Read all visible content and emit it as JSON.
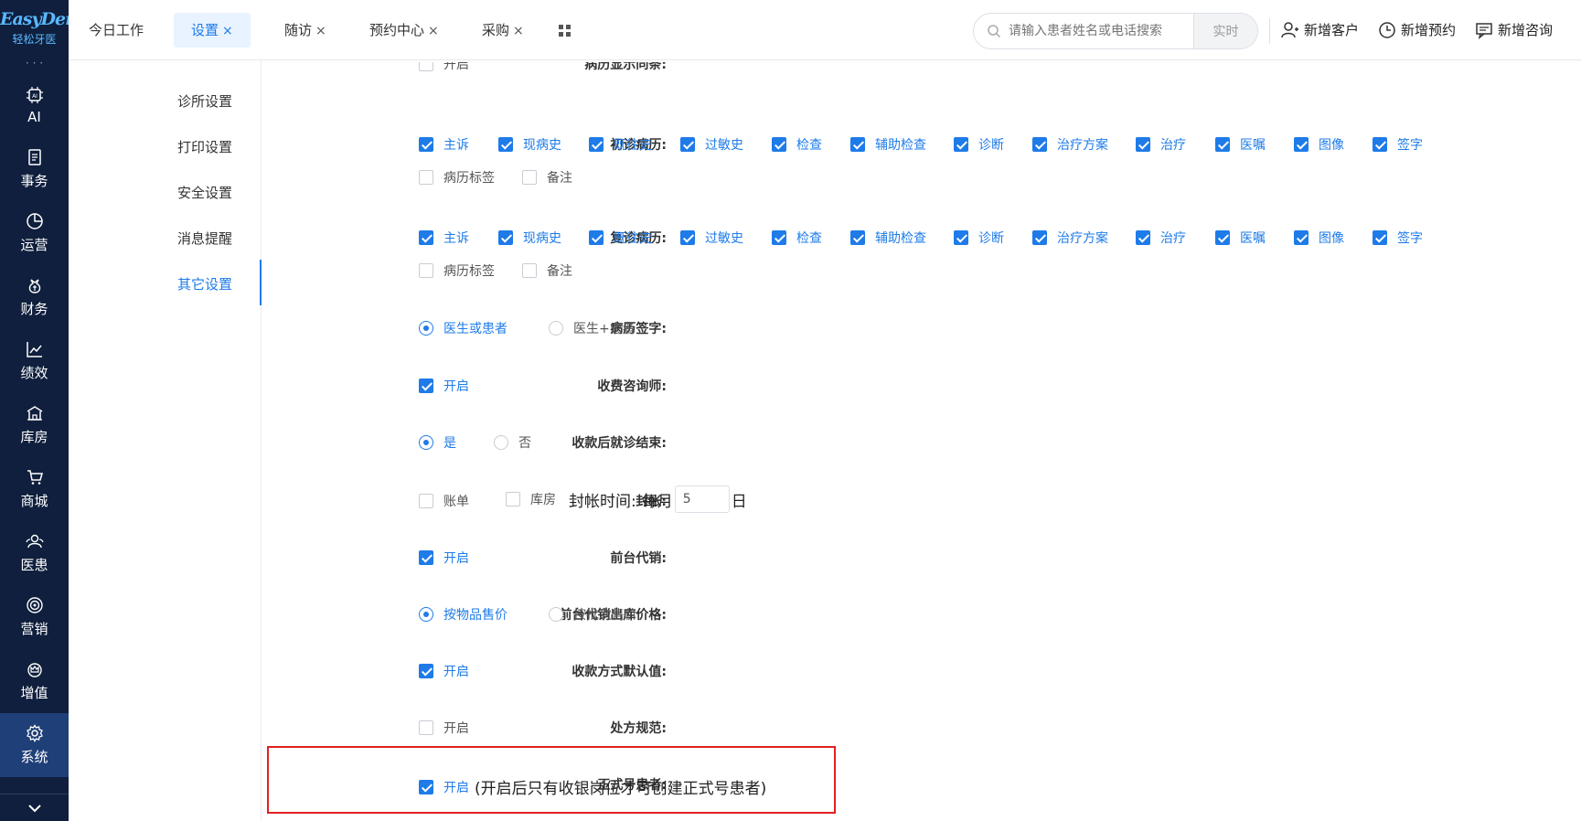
{
  "brand": {
    "logo_text": "EasyDent",
    "logo_sub": "轻松牙医",
    "accent": "#1e7be8"
  },
  "leftnav": {
    "items": [
      {
        "label": "AI",
        "icon": "ai-chip-icon"
      },
      {
        "label": "事务",
        "icon": "document-icon"
      },
      {
        "label": "运营",
        "icon": "pie-chart-icon"
      },
      {
        "label": "财务",
        "icon": "money-bag-icon"
      },
      {
        "label": "绩效",
        "icon": "line-chart-icon"
      },
      {
        "label": "库房",
        "icon": "warehouse-icon"
      },
      {
        "label": "商城",
        "icon": "cart-icon"
      },
      {
        "label": "医患",
        "icon": "people-icon"
      },
      {
        "label": "营销",
        "icon": "target-icon"
      },
      {
        "label": "增值",
        "icon": "crown-icon"
      },
      {
        "label": "系统",
        "icon": "gear-icon"
      }
    ]
  },
  "tabs": [
    {
      "label": "今日工作"
    },
    {
      "label": "设置",
      "closable": "×"
    },
    {
      "label": "随访",
      "closable": "×"
    },
    {
      "label": "预约中心",
      "closable": "×"
    },
    {
      "label": "采购",
      "closable": "×"
    }
  ],
  "search": {
    "placeholder": "请输入患者姓名或电话搜索",
    "realtime_label": "实时"
  },
  "top_actions": {
    "add_customer": "新增客户",
    "add_appointment": "新增预约",
    "add_consult": "新增咨询"
  },
  "subnav": {
    "items": [
      "诊所设置",
      "打印设置",
      "安全设置",
      "消息提醒",
      "其它设置"
    ],
    "active_index": 4
  },
  "form": {
    "partial_top": {
      "label": "病历显示同条:",
      "option": "开启"
    },
    "first_visit": {
      "label": "初诊病历:",
      "options": [
        "主诉",
        "现病史",
        "既往史",
        "过敏史",
        "检查",
        "辅助检查",
        "诊断",
        "治疗方案",
        "治疗",
        "医嘱",
        "图像",
        "签字",
        "病历标签",
        "备注"
      ]
    },
    "return_visit": {
      "label": "复诊病历:",
      "options": [
        "主诉",
        "现病史",
        "既往史",
        "过敏史",
        "检查",
        "辅助检查",
        "诊断",
        "治疗方案",
        "治疗",
        "医嘱",
        "图像",
        "签字",
        "病历标签",
        "备注"
      ]
    },
    "record_signature": {
      "label": "病历签字:",
      "options": [
        "医生或患者",
        "医生+患者"
      ]
    },
    "charge_consultant": {
      "label": "收费咨询师:",
      "option": "开启"
    },
    "end_after_payment": {
      "label": "收款后就诊结束:",
      "options": [
        "是",
        "否"
      ]
    },
    "seal_account": {
      "label": "封帐:",
      "opt_bill": "账单",
      "opt_store": "库房",
      "time_label": "封帐时间:",
      "monthly": "每月",
      "day_value": "5",
      "day_suffix": "日"
    },
    "front_consign": {
      "label": "前台代销:",
      "option": "开启"
    },
    "consign_price": {
      "label": "前台代销出库价格:",
      "options": [
        "按物品售价",
        "按批次售价"
      ]
    },
    "payment_default": {
      "label": "收款方式默认值:",
      "option": "开启"
    },
    "prescription_rule": {
      "label": "处方规范:",
      "option": "开启"
    },
    "formal_patient": {
      "label": "正式号患者:",
      "option": "开启",
      "note": "(开启后只有收银岗位才可创建正式号患者)"
    }
  }
}
